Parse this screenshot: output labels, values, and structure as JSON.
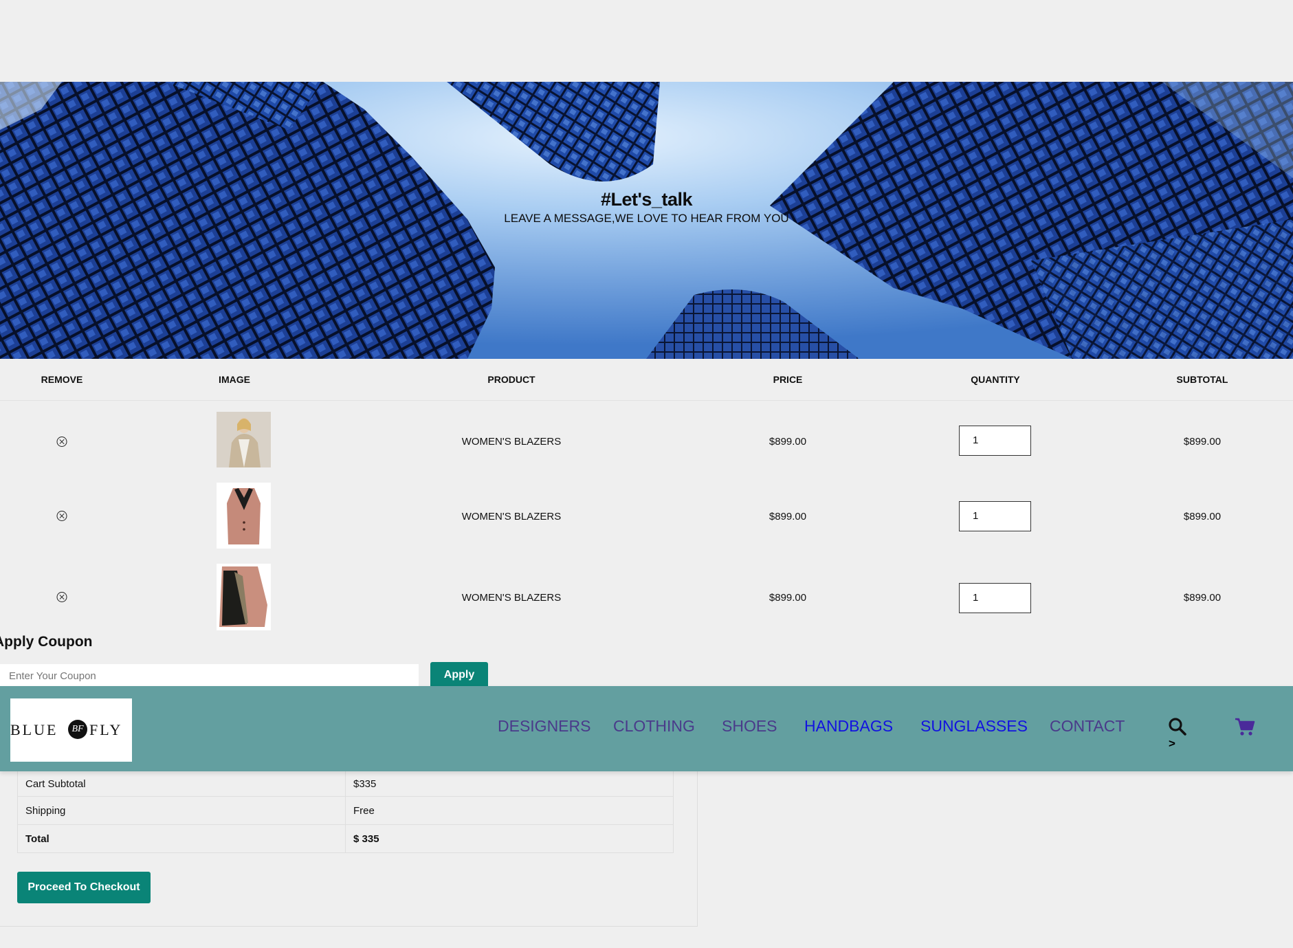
{
  "hero": {
    "title": "#Let's_talk",
    "subtitle": "LEAVE A MESSAGE,WE LOVE TO HEAR FROM YOU"
  },
  "cart": {
    "headers": [
      "REMOVE",
      "IMAGE",
      "PRODUCT",
      "PRICE",
      "QUANTITY",
      "SUBTOTAL"
    ],
    "rows": [
      {
        "product": "WOMEN'S BLAZERS",
        "price": "$899.00",
        "quantity": "1",
        "subtotal": "$899.00"
      },
      {
        "product": "WOMEN'S BLAZERS",
        "price": "$899.00",
        "quantity": "1",
        "subtotal": "$899.00"
      },
      {
        "product": "WOMEN'S BLAZERS",
        "price": "$899.00",
        "quantity": "1",
        "subtotal": "$899.00"
      }
    ]
  },
  "coupon": {
    "title": "Apply Coupon",
    "placeholder": "Enter Your Coupon",
    "button": "Apply"
  },
  "nav": {
    "logo_left": "BLUE",
    "logo_mark": "BF",
    "logo_right": "FLY",
    "links": [
      "DESIGNERS",
      "CLOTHING",
      "SHOES",
      "HANDBAGS",
      "SUNGLASSES",
      "CONTACT"
    ],
    "arrow": ">",
    "icons": [
      "search-icon",
      "cart-icon"
    ]
  },
  "totals": {
    "rows": [
      {
        "label": "Cart Subtotal",
        "value": "$335"
      },
      {
        "label": "Shipping",
        "value": "Free"
      },
      {
        "label": "Total",
        "value": "$ 335"
      }
    ],
    "checkout_button": "Proceed To Checkout"
  },
  "colors": {
    "background": "#efefef",
    "navbar": "#639fa0",
    "accent_button": "#0a8477",
    "link_visited": "#4a3a8a",
    "link_unvisited": "#1212e0"
  }
}
